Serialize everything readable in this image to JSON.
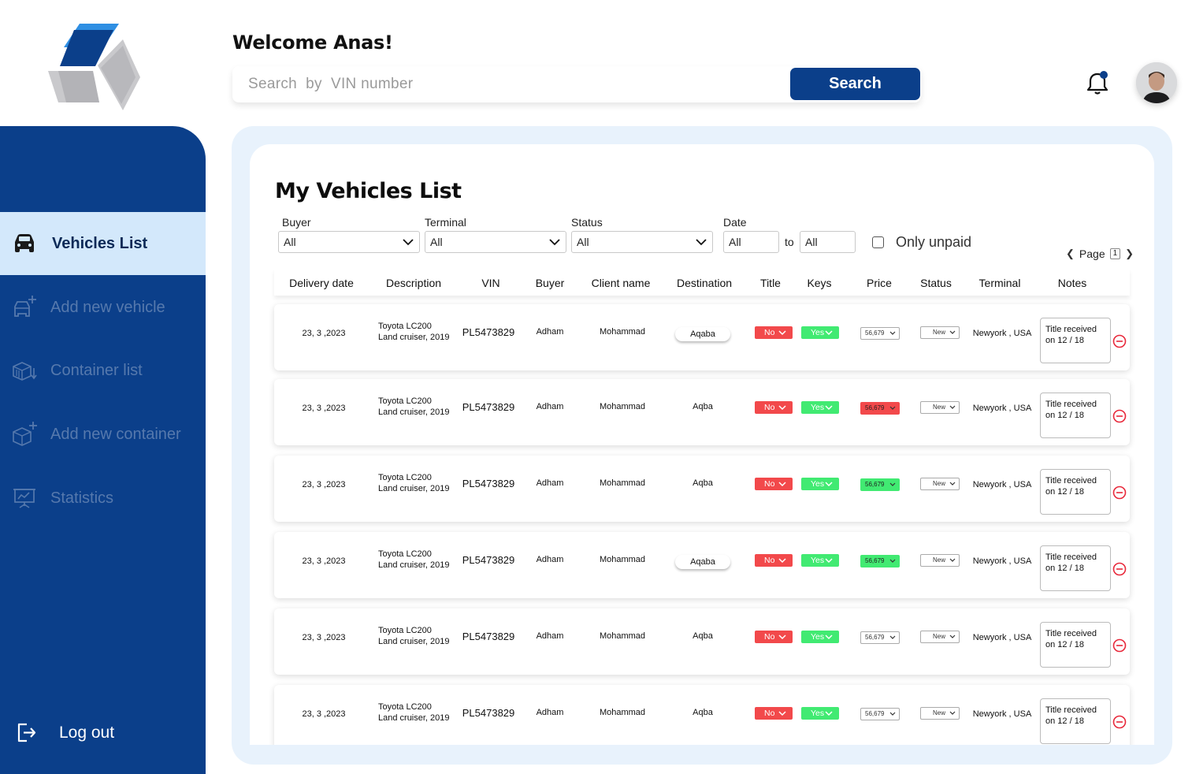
{
  "header": {
    "welcome": "Welcome Anas!",
    "search_placeholder": "Search  by  VIN number",
    "search_button": "Search"
  },
  "sidebar": {
    "items": [
      {
        "label": "Vehicles List",
        "icon": "car-icon",
        "active": true
      },
      {
        "label": "Add new vehicle",
        "icon": "add-vehicle-icon",
        "active": false
      },
      {
        "label": "Container list",
        "icon": "container-list-icon",
        "active": false
      },
      {
        "label": "Add new container",
        "icon": "add-container-icon",
        "active": false
      },
      {
        "label": "Statistics",
        "icon": "statistics-icon",
        "active": false
      }
    ],
    "logout": "Log out"
  },
  "main": {
    "title": "My Vehicles List",
    "filters": {
      "buyer_label": "Buyer",
      "buyer_value": "All",
      "terminal_label": "Terminal",
      "terminal_value": "All",
      "status_label": "Status",
      "status_value": "All",
      "date_label": "Date",
      "date_from": "All",
      "date_to_label": "to",
      "date_to": "All",
      "only_unpaid": "Only unpaid"
    },
    "pager": {
      "label": "Page",
      "page": "1"
    },
    "columns": [
      "Delivery date",
      "Description",
      "VIN",
      "Buyer",
      "Client name",
      "Destination",
      "Title",
      "Keys",
      "Price",
      "Status",
      "Terminal",
      "Notes"
    ],
    "rows": [
      {
        "date": "23, 3 ,2023",
        "desc1": "Toyota LC200",
        "desc2": "Land cruiser, 2019",
        "vin": "PL5473829",
        "buyer": "Adham",
        "client": "Mohammad",
        "destination": "Aqaba",
        "dest_pill": true,
        "title": "No",
        "keys": "Yes",
        "price": "56,679",
        "price_state": "neutral",
        "status": "New",
        "terminal": "Newyork , USA",
        "note1": "Title received",
        "note2": "on 12 / 18"
      },
      {
        "date": "23, 3 ,2023",
        "desc1": "Toyota LC200",
        "desc2": "Land cruiser, 2019",
        "vin": "PL5473829",
        "buyer": "Adham",
        "client": "Mohammad",
        "destination": "Aqba",
        "dest_pill": false,
        "title": "No",
        "keys": "Yes",
        "price": "56,679",
        "price_state": "red",
        "status": "New",
        "terminal": "Newyork , USA",
        "note1": "Title received",
        "note2": "on 12 / 18"
      },
      {
        "date": "23, 3 ,2023",
        "desc1": "Toyota LC200",
        "desc2": "Land cruiser, 2019",
        "vin": "PL5473829",
        "buyer": "Adham",
        "client": "Mohammad",
        "destination": "Aqba",
        "dest_pill": false,
        "title": "No",
        "keys": "Yes",
        "price": "56,679",
        "price_state": "green",
        "status": "New",
        "terminal": "Newyork , USA",
        "note1": "Title received",
        "note2": "on 12 / 18"
      },
      {
        "date": "23, 3 ,2023",
        "desc1": "Toyota LC200",
        "desc2": "Land cruiser, 2019",
        "vin": "PL5473829",
        "buyer": "Adham",
        "client": "Mohammad",
        "destination": "Aqaba",
        "dest_pill": true,
        "title": "No",
        "keys": "Yes",
        "price": "56,679",
        "price_state": "green",
        "status": "New",
        "terminal": "Newyork , USA",
        "note1": "Title received",
        "note2": "on 12 / 18"
      },
      {
        "date": "23, 3 ,2023",
        "desc1": "Toyota LC200",
        "desc2": "Land cruiser, 2019",
        "vin": "PL5473829",
        "buyer": "Adham",
        "client": "Mohammad",
        "destination": "Aqba",
        "dest_pill": false,
        "title": "No",
        "keys": "Yes",
        "price": "56,679",
        "price_state": "neutral",
        "status": "New",
        "terminal": "Newyork , USA",
        "note1": "Title received",
        "note2": "on 12 / 18"
      },
      {
        "date": "23, 3 ,2023",
        "desc1": "Toyota LC200",
        "desc2": "Land cruiser, 2019",
        "vin": "PL5473829",
        "buyer": "Adham",
        "client": "Mohammad",
        "destination": "Aqba",
        "dest_pill": false,
        "title": "No",
        "keys": "Yes",
        "price": "56,679",
        "price_state": "neutral",
        "status": "New",
        "terminal": "Newyork , USA",
        "note1": "Title received",
        "note2": "on 12 / 18"
      }
    ]
  },
  "colors": {
    "brand": "#0b3f8a",
    "active_nav_bg": "#d3e8fb",
    "panel_bg": "#e8f2fc",
    "red": "#f2494b",
    "green": "#41ea72"
  }
}
